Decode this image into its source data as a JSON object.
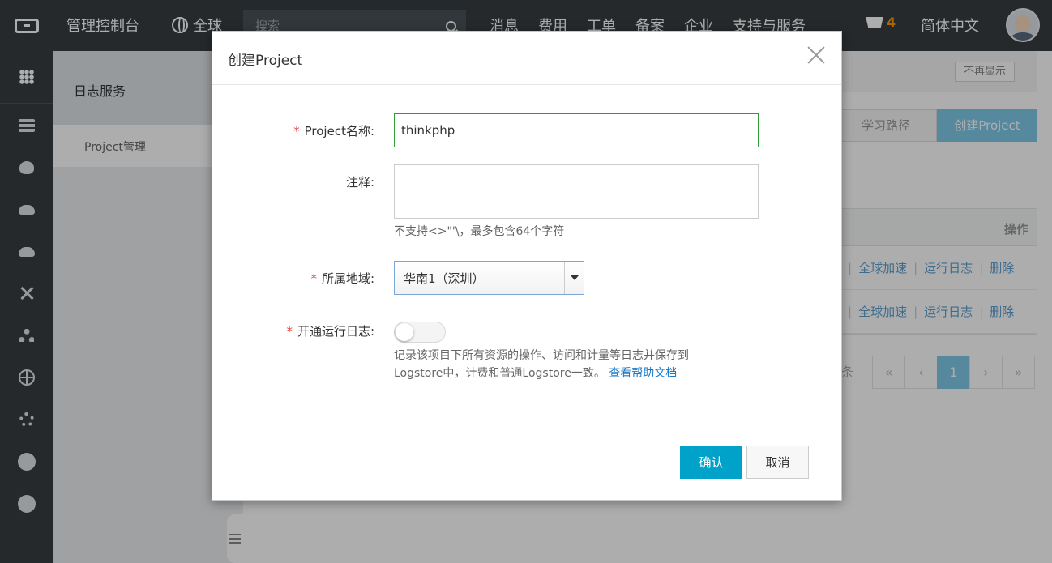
{
  "topbar": {
    "console": "管理控制台",
    "region": "全球",
    "search_placeholder": "搜索",
    "nav": [
      "消息",
      "费用",
      "工单",
      "备案",
      "企业",
      "支持与服务"
    ],
    "cart_count": "4",
    "language": "简体中文"
  },
  "rail_icons": [
    "grid-icon",
    "server-icon",
    "database-icon",
    "cloud-icon",
    "cloud-upload-icon",
    "network-icon",
    "cluster-icon",
    "globe-icon",
    "gear-cloud-icon",
    "circle-icon",
    "circle-icon"
  ],
  "sidebar": {
    "title": "日志服务",
    "items": [
      {
        "label": "Project管理"
      }
    ]
  },
  "main": {
    "notice_dismiss": "不再显示",
    "learn_path": "学习路径",
    "create_project": "创建Project",
    "table_header_action": "操作",
    "rows": [
      {
        "accelerate": "全球加速",
        "run_log": "运行日志",
        "delete": "删除"
      },
      {
        "accelerate": "全球加速",
        "run_log": "运行日志",
        "delete": "删除"
      }
    ],
    "pager_text": "条",
    "pager": {
      "first": "«",
      "prev": "‹",
      "current": "1",
      "next": "›",
      "last": "»"
    }
  },
  "modal": {
    "title": "创建Project",
    "project_name_label": "Project名称:",
    "project_name_value": "thinkphp",
    "comment_label": "注释:",
    "comment_hint": "不支持<>\"'\\，最多包含64个字符",
    "region_label": "所属地域:",
    "region_value": "华南1（深圳）",
    "run_log_label": "开通运行日志:",
    "run_log_enabled": false,
    "run_log_hint_1": "记录该项目下所有资源的操作、访问和计量等日志并保存到",
    "run_log_hint_2": "Logstore中，计费和普通Logstore一致。",
    "help_link": "查看帮助文档",
    "required_mark": "*",
    "ok": "确认",
    "cancel": "取消"
  }
}
